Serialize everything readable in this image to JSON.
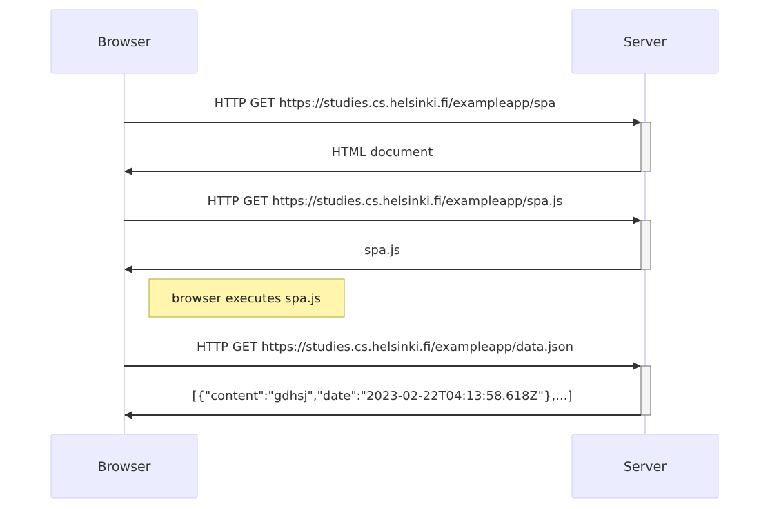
{
  "actors": {
    "browser": "Browser",
    "server": "Server"
  },
  "messages": [
    {
      "text": "HTTP GET https://studies.cs.helsinki.fi/exampleapp/spa",
      "from": "Browser",
      "to": "Server"
    },
    {
      "text": "HTML document",
      "from": "Server",
      "to": "Browser"
    },
    {
      "text": "HTTP GET https://studies.cs.helsinki.fi/exampleapp/spa.js",
      "from": "Browser",
      "to": "Server"
    },
    {
      "text": "spa.js",
      "from": "Server",
      "to": "Browser"
    },
    {
      "text": "HTTP GET https://studies.cs.helsinki.fi/exampleapp/data.json",
      "from": "Browser",
      "to": "Server"
    },
    {
      "text": "[{\"content\":\"gdhsj\",\"date\":\"2023-02-22T04:13:58.618Z\"},...]",
      "from": "Server",
      "to": "Browser"
    }
  ],
  "note": "browser executes spa.js",
  "colors": {
    "actor_fill": "#ECECFF",
    "actor_stroke": "#CCCCFF",
    "note_fill": "#FFF5AD",
    "note_stroke": "#AAAA33",
    "line": "#333333"
  }
}
